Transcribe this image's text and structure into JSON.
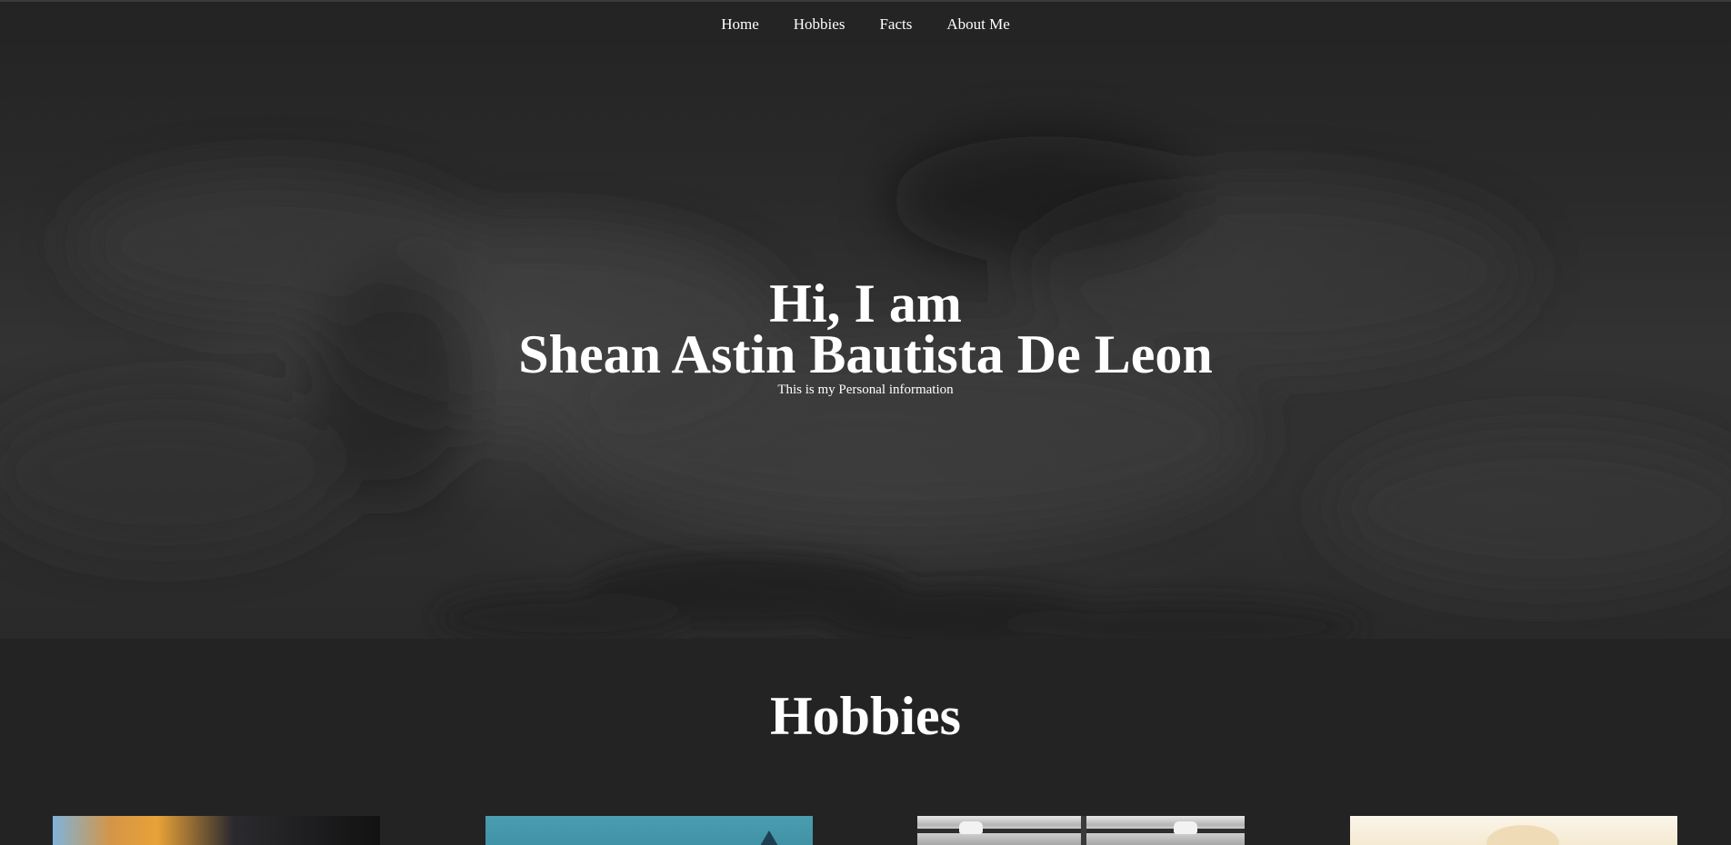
{
  "nav": {
    "items": [
      {
        "label": "Home"
      },
      {
        "label": "Hobbies"
      },
      {
        "label": "Facts"
      },
      {
        "label": "About Me"
      }
    ]
  },
  "hero": {
    "greeting": "Hi, I am",
    "name": "Shean Astin Bautista De Leon",
    "subtitle": "This is my Personal information"
  },
  "hobbies": {
    "title": "Hobbies",
    "cards": [
      {
        "name": "hobby-card-1"
      },
      {
        "name": "hobby-card-2"
      },
      {
        "name": "hobby-card-3"
      },
      {
        "name": "hobby-card-4"
      }
    ]
  },
  "colors": {
    "background": "#232323",
    "text": "#ffffff"
  }
}
